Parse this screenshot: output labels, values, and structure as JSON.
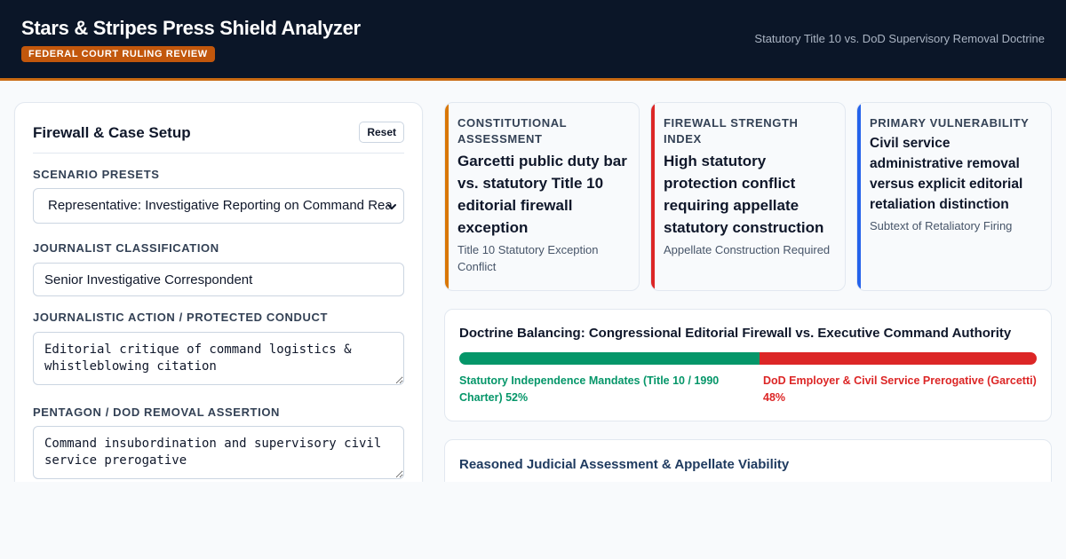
{
  "header": {
    "title": "Stars & Stripes Press Shield Analyzer",
    "badge": "FEDERAL COURT RULING REVIEW",
    "subtitle": "Statutory Title 10 vs. DoD Supervisory Removal Doctrine"
  },
  "setup": {
    "title": "Firewall & Case Setup",
    "reset_label": "Reset",
    "scenario": {
      "label": "SCENARIO PRESETS",
      "selected": "Representative: Investigative Reporting on Command Rea"
    },
    "classification": {
      "label": "JOURNALIST CLASSIFICATION",
      "value": "Senior Investigative Correspondent"
    },
    "action": {
      "label": "JOURNALISTIC ACTION / PROTECTED CONDUCT",
      "value": "Editorial critique of command logistics & whistleblowing citation"
    },
    "assertion": {
      "label": "PENTAGON / DOD REMOVAL ASSERTION",
      "value": "Command insubordination and supervisory civil service prerogative"
    }
  },
  "stats": [
    {
      "label": "CONSTITUTIONAL ASSESSMENT",
      "value": "Garcetti public duty bar vs. statutory Title 10 editorial firewall exception",
      "note": "Title 10 Statutory Exception Conflict",
      "color": "#d97706"
    },
    {
      "label": "FIREWALL STRENGTH INDEX",
      "value": "High statutory protection conflict requiring appellate statutory construction",
      "note": "Appellate Construction Required",
      "color": "#dc2626"
    },
    {
      "label": "PRIMARY VULNERABILITY",
      "value": "Civil service administrative removal versus explicit editorial retaliation distinction",
      "note": "Subtext of Retaliatory Firing",
      "color": "#2563eb"
    }
  ],
  "doctrine": {
    "title": "Doctrine Balancing: Congressional Editorial Firewall vs. Executive Command Authority",
    "independence_share": 52,
    "left_label": "Statutory Independence Mandates (Title 10 / 1990 Charter) 52%",
    "right_label": "DoD Employer & Civil Service Prerogative (Garcetti) 48%",
    "green": "#059669",
    "red": "#dc2626"
  },
  "assessment": {
    "title": "Reasoned Judicial Assessment & Appellate Viability"
  }
}
